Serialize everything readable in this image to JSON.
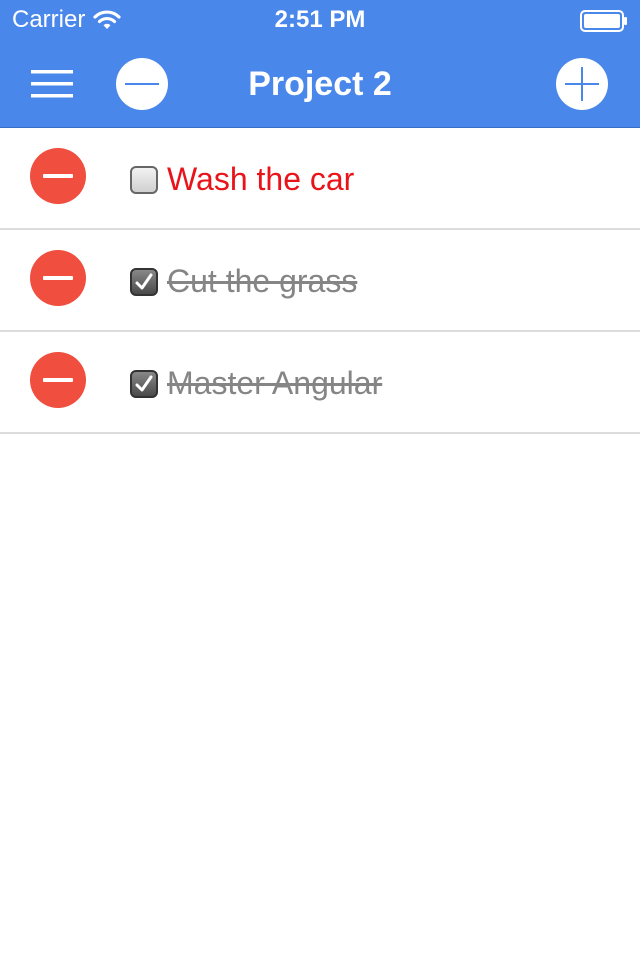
{
  "status_bar": {
    "carrier": "Carrier",
    "time": "2:51 PM"
  },
  "nav": {
    "title": "Project 2",
    "menu_icon": "hamburger-menu-icon",
    "remove_mode_icon": "minus-circle-icon",
    "add_icon": "plus-circle-icon"
  },
  "colors": {
    "header": "#4a87ea",
    "delete": "#f04e3e",
    "pending_text": "#e8141a",
    "done_text": "#858585"
  },
  "tasks": [
    {
      "label": "Wash the car",
      "done": false
    },
    {
      "label": "Cut the grass",
      "done": true
    },
    {
      "label": "Master Angular",
      "done": true
    }
  ]
}
